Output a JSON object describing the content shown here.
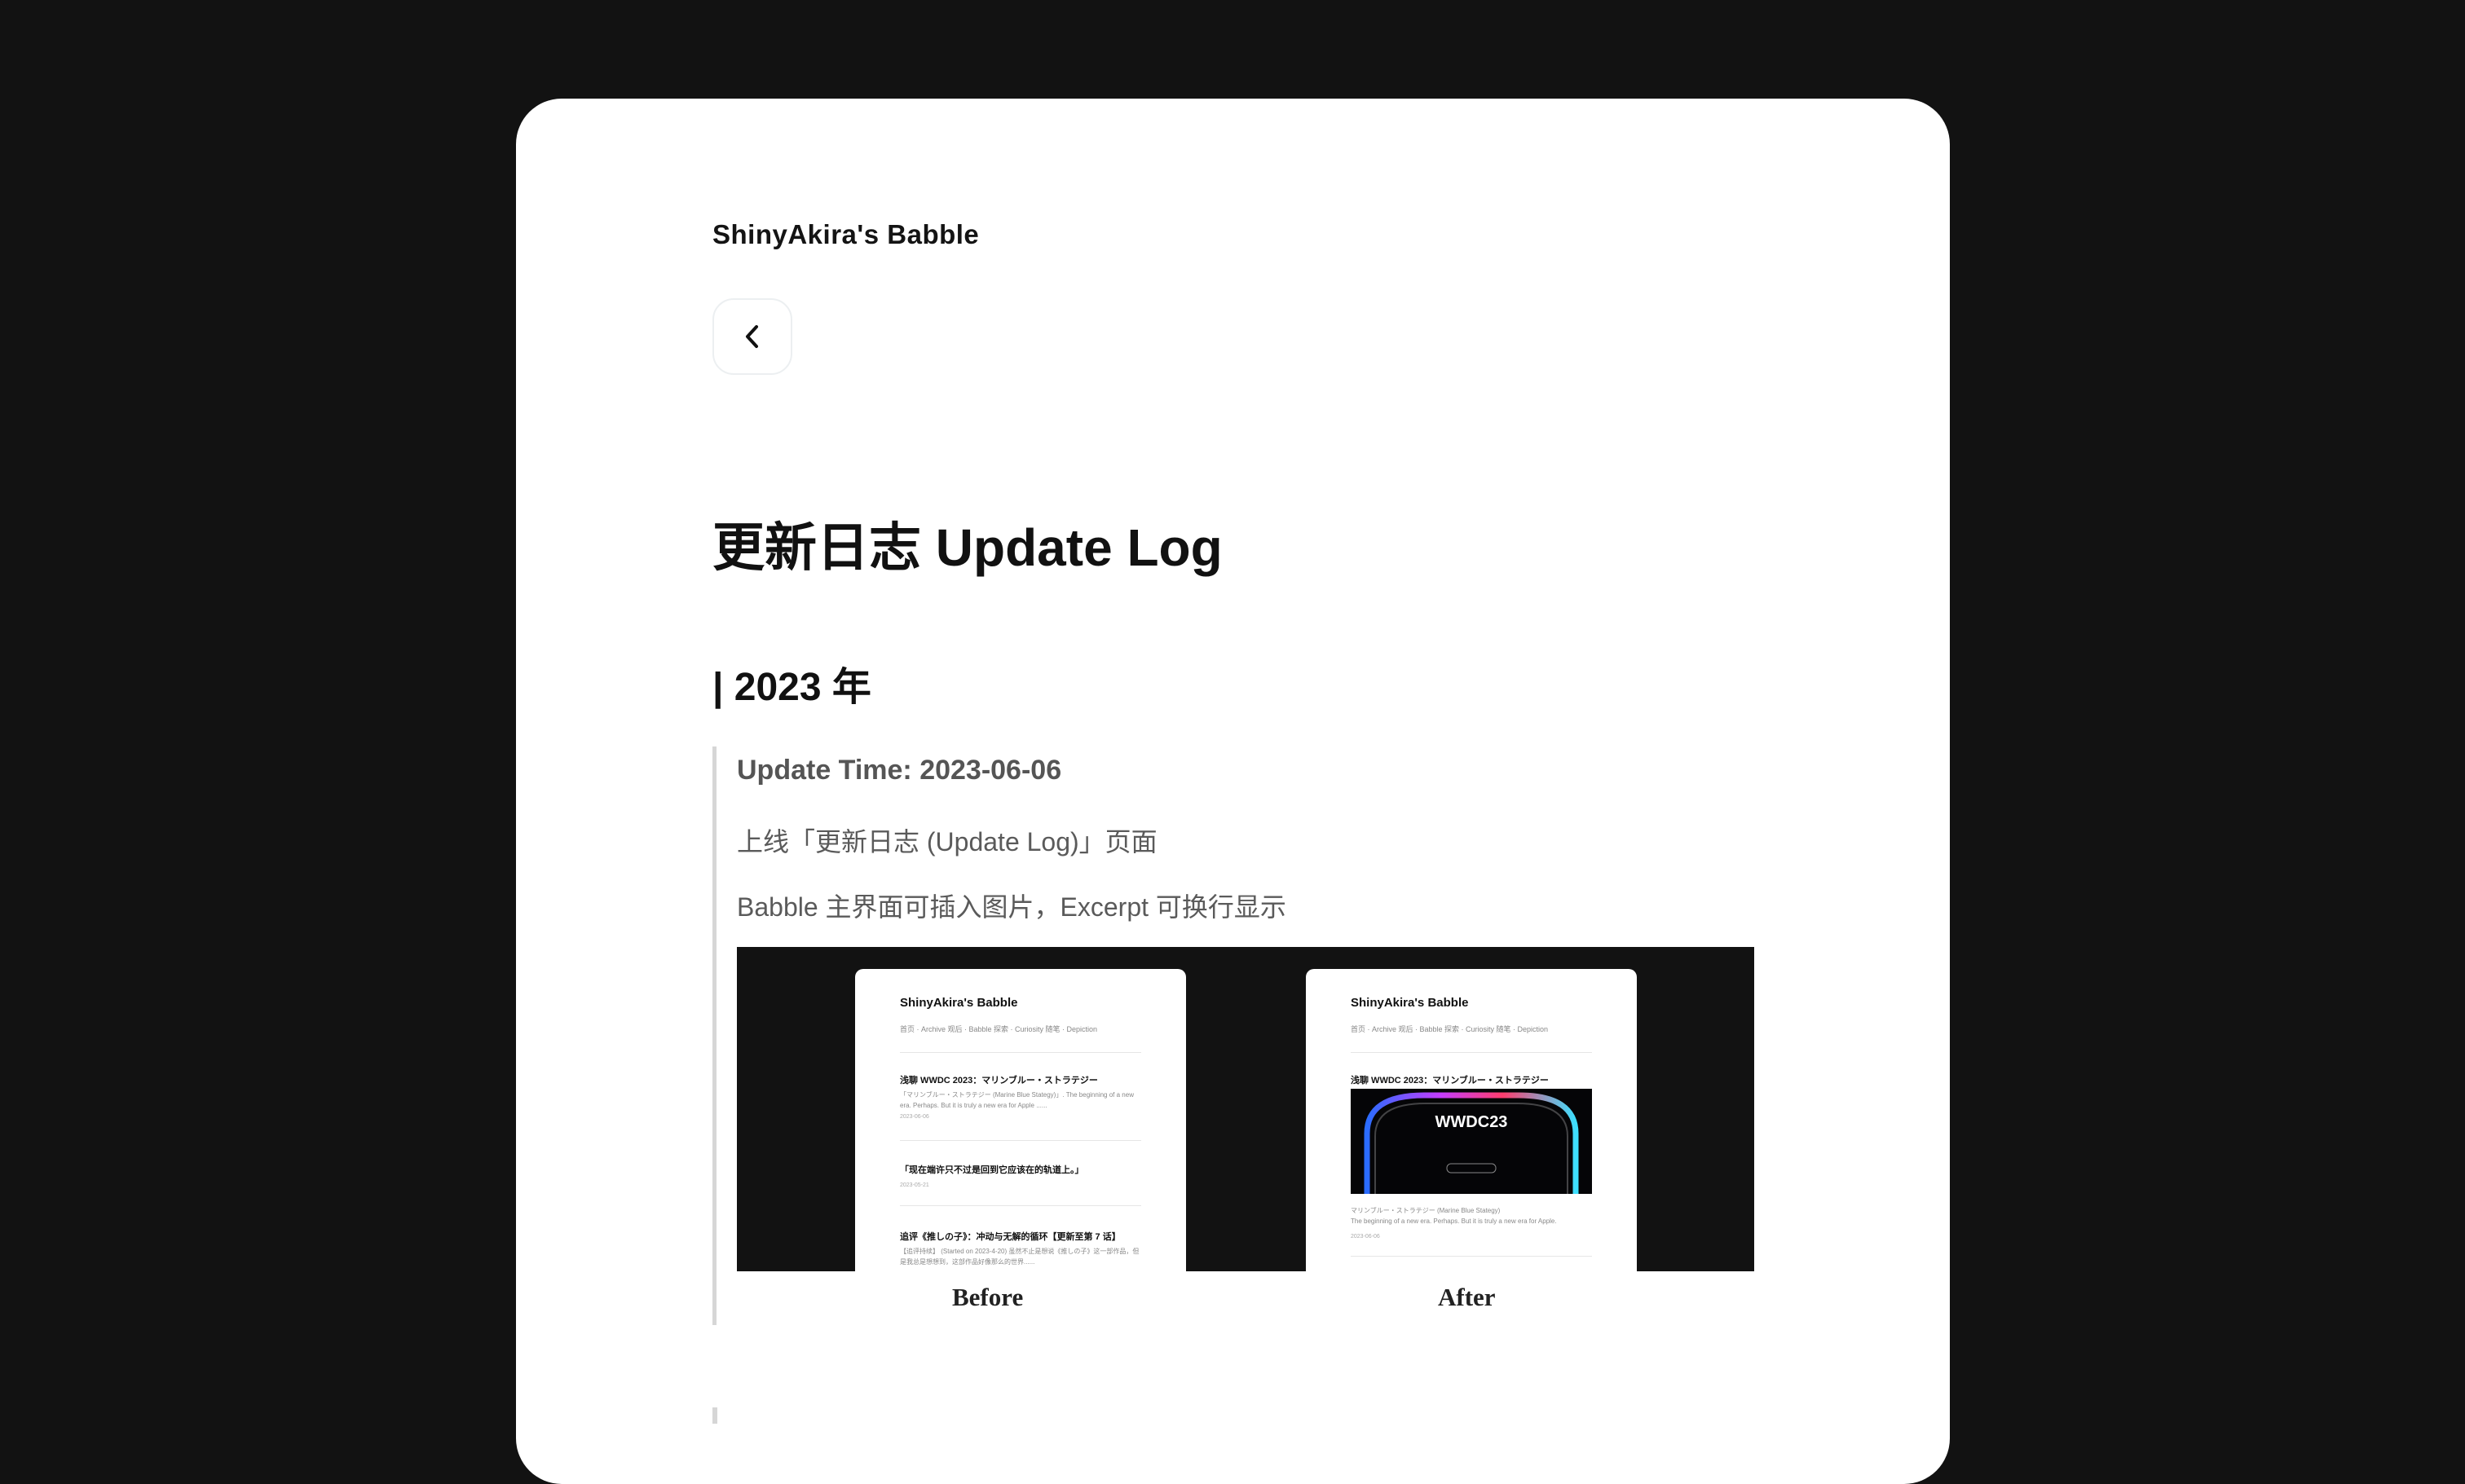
{
  "site": {
    "title": "ShinyAkira's Babble"
  },
  "page": {
    "title": "更新日志 Update Log"
  },
  "section": {
    "year_heading": "| 2023 年"
  },
  "entry": {
    "time": "Update Time: 2023-06-06",
    "lines": [
      "上线「更新日志 (Update Log)」页面",
      "Babble 主界面可插入图片，Excerpt 可换行显示"
    ]
  },
  "comparison": {
    "before_caption": "Before",
    "after_caption": "After",
    "mock": {
      "site_title": "ShinyAkira's Babble",
      "nav": "首页 · Archive   观后 · Babble   探索 · Curiosity   随笔 · Depiction"
    },
    "before_posts": [
      {
        "title": "浅聊 WWDC 2023：マリンブルー・ストラテジー",
        "excerpt": "「マリンブルー・ストラテジー (Marine Blue Stategy)」. The beginning of a new era. Perhaps. But it is truly a new era for Apple ......",
        "date": "2023-06-06"
      },
      {
        "title": "「现在端许只不过是回到它应该在的轨道上。」",
        "excerpt": "",
        "date": "2023-05-21"
      },
      {
        "title": "追评《推しの子》：冲动与无解的循环【更新至第 7 话】",
        "excerpt": "【追评持续】 (Started on 2023-4-20) 虽然不止是想说《推しの子》这一部作品，但是我总是想想到，这部作品好像那么的世界......",
        "date": ""
      }
    ],
    "after_post": {
      "title": "浅聊 WWDC 2023：マリンブルー・ストラテジー",
      "image_text": "WWDC23",
      "excerpt": "マリンブルー・ストラテジー (Marine Blue Stategy)\nThe beginning of a new era. Perhaps. But it is truly a new era for Apple.",
      "date": "2023-06-06"
    }
  }
}
